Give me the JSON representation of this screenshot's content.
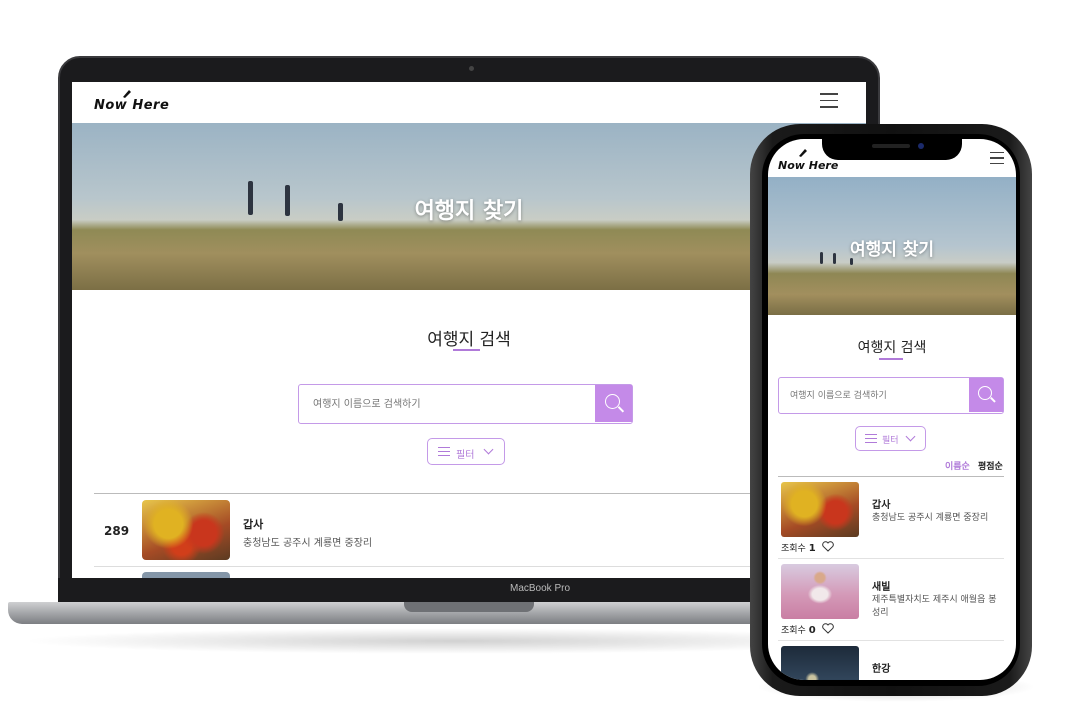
{
  "brand": {
    "logo_text": "Now Here"
  },
  "device": {
    "laptop_label": "MacBook Pro"
  },
  "hero": {
    "title": "여행지 찾기"
  },
  "search_section": {
    "title": "여행지 검색",
    "placeholder": "여행지 이름으로 검색하기",
    "filter_label": "필터"
  },
  "sort": {
    "by_name": "이름순",
    "by_rating": "평점순"
  },
  "views_label": "조회수",
  "laptop_list": [
    {
      "rank": "289",
      "name": "갑사",
      "address": "충청남도 공주시 계룡면 중장리"
    }
  ],
  "phone_list": [
    {
      "name": "갑사",
      "address": "충청남도 공주시 계룡면 중장리",
      "views": "1"
    },
    {
      "name": "새빌",
      "address": "제주특별자치도 제주시 애월읍 봉성리",
      "views": "0"
    },
    {
      "name": "한강",
      "address": "",
      "views": ""
    }
  ],
  "colors": {
    "accent": "#c48ae8",
    "accent_text": "#b07ad9"
  },
  "icons": [
    "search-icon",
    "filter-icon",
    "chevron-down-icon",
    "menu-icon",
    "heart-icon"
  ]
}
